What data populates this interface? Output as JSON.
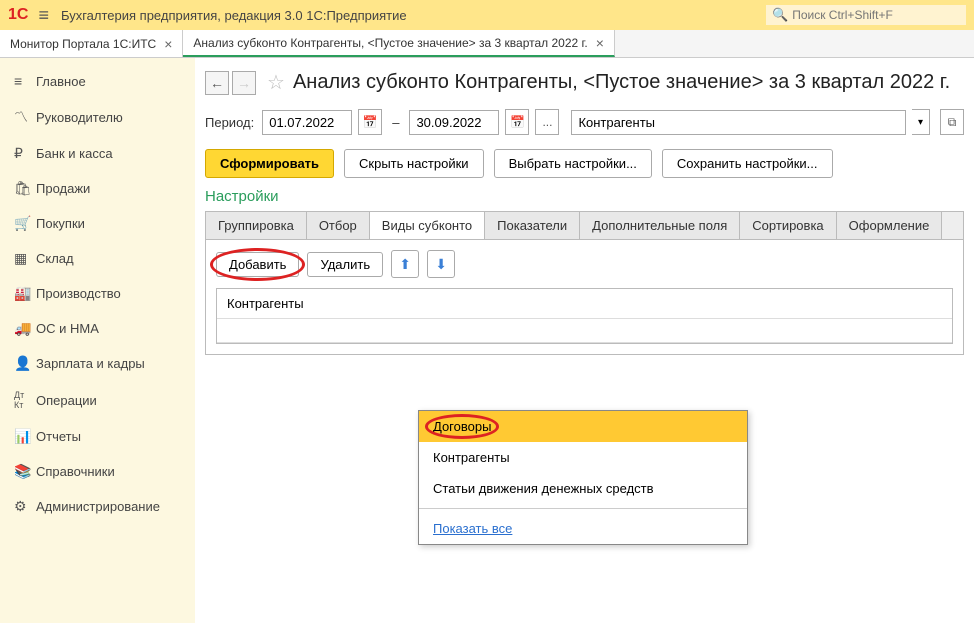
{
  "header": {
    "app_title": "Бухгалтерия предприятия, редакция 3.0 1С:Предприятие",
    "search_placeholder": "Поиск Ctrl+Shift+F"
  },
  "tabs": [
    {
      "label": "Монитор Портала 1С:ИТС"
    },
    {
      "label": "Анализ субконто Контрагенты, <Пустое значение> за 3 квартал 2022 г."
    }
  ],
  "sidebar": {
    "items": [
      {
        "label": "Главное",
        "icon": "≡"
      },
      {
        "label": "Руководителю",
        "icon": "📈"
      },
      {
        "label": "Банк и касса",
        "icon": "₽"
      },
      {
        "label": "Продажи",
        "icon": "🛍"
      },
      {
        "label": "Покупки",
        "icon": "🛒"
      },
      {
        "label": "Склад",
        "icon": "▦"
      },
      {
        "label": "Производство",
        "icon": "🏭"
      },
      {
        "label": "ОС и НМА",
        "icon": "🚚"
      },
      {
        "label": "Зарплата и кадры",
        "icon": "👤"
      },
      {
        "label": "Операции",
        "icon": "Дт Кт"
      },
      {
        "label": "Отчеты",
        "icon": "📊"
      },
      {
        "label": "Справочники",
        "icon": "📚"
      },
      {
        "label": "Администрирование",
        "icon": "⚙"
      }
    ]
  },
  "page": {
    "title": "Анализ субконто Контрагенты, <Пустое значение> за 3 квартал 2022 г.",
    "period_label": "Период:",
    "date_from": "01.07.2022",
    "date_to": "30.09.2022",
    "dash": "–",
    "dots": "...",
    "subkonto_value": "Контрагенты"
  },
  "actions": {
    "generate": "Сформировать",
    "hide_settings": "Скрыть настройки",
    "choose_settings": "Выбрать настройки...",
    "save_settings": "Сохранить настройки..."
  },
  "settings_title": "Настройки",
  "setting_tabs": [
    "Группировка",
    "Отбор",
    "Виды субконто",
    "Показатели",
    "Дополнительные поля",
    "Сортировка",
    "Оформление"
  ],
  "panel": {
    "add": "Добавить",
    "delete": "Удалить",
    "list_header": "Контрагенты"
  },
  "dropdown": {
    "items": [
      "Договоры",
      "Контрагенты",
      "Статьи движения денежных средств"
    ],
    "show_all": "Показать все"
  }
}
